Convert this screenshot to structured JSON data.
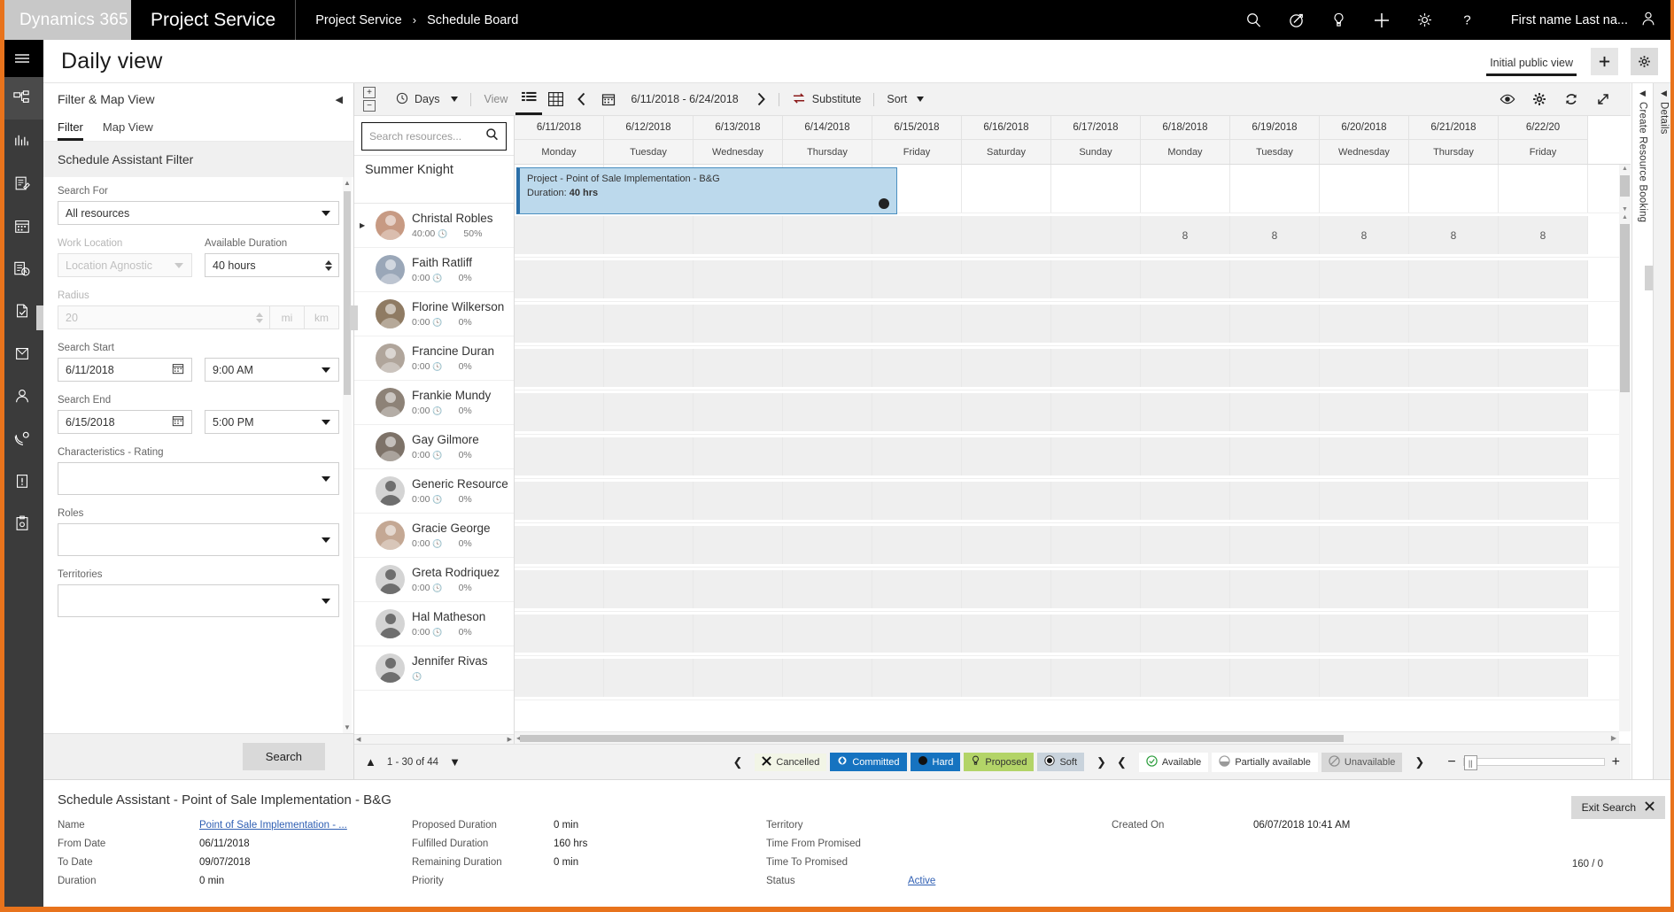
{
  "topnav": {
    "brand": "Dynamics 365",
    "app_name": "Project Service",
    "breadcrumb": [
      "Project Service",
      "Schedule Board"
    ],
    "breadcrumb_sep": "›",
    "icons": [
      "search-icon",
      "assistant-icon",
      "lightbulb-icon",
      "plus-icon",
      "gear-icon",
      "help-icon"
    ],
    "user_name": "First name Last na..."
  },
  "rail": {
    "items": [
      {
        "name": "hamburger-menu"
      },
      {
        "name": "sitemap-icon"
      },
      {
        "name": "dashboard-icon"
      },
      {
        "name": "notes-icon"
      },
      {
        "name": "calendar-icon"
      },
      {
        "name": "schedule-board-icon"
      },
      {
        "name": "document-check-icon"
      },
      {
        "name": "archive-icon"
      },
      {
        "name": "contact-icon"
      },
      {
        "name": "phone-settings-icon"
      },
      {
        "name": "alert-icon"
      },
      {
        "name": "clipboard-settings-icon"
      }
    ]
  },
  "titlebar": {
    "title": "Daily view",
    "view_tab": "Initial public view",
    "add_label": "+",
    "settings_icon": "gear-icon"
  },
  "filter_panel": {
    "header": "Filter & Map View",
    "collapse_icon": "chevron-left-icon",
    "tabs": [
      {
        "label": "Filter",
        "active": true
      },
      {
        "label": "Map View",
        "active": false
      }
    ],
    "section_title": "Schedule Assistant Filter",
    "fields": {
      "search_for": {
        "label": "Search For",
        "value": "All resources"
      },
      "work_location": {
        "label": "Work Location",
        "value": "Location Agnostic",
        "disabled": true
      },
      "available_duration": {
        "label": "Available Duration",
        "value": "40 hours"
      },
      "radius": {
        "label": "Radius",
        "value": "20",
        "unit_mi": "mi",
        "unit_km": "km",
        "disabled": true
      },
      "search_start": {
        "label": "Search Start",
        "date": "6/11/2018",
        "time": "9:00 AM"
      },
      "search_end": {
        "label": "Search End",
        "date": "6/15/2018",
        "time": "5:00 PM"
      },
      "characteristics_rating": {
        "label": "Characteristics - Rating",
        "value": ""
      },
      "roles": {
        "label": "Roles",
        "value": ""
      },
      "territories": {
        "label": "Territories",
        "value": ""
      }
    },
    "search_button": "Search"
  },
  "board_toolbar": {
    "expand_icon": "expand-all-icon",
    "collapse_icon": "collapse-all-icon",
    "scale_label": "Days",
    "view_label": "View",
    "list_view_icon": "list-view-icon",
    "grid_view_icon": "grid-view-icon",
    "prev_icon": "chevron-left-icon",
    "calendar_icon": "calendar-icon",
    "date_range": "6/11/2018 - 6/24/2018",
    "next_icon": "chevron-right-icon",
    "substitute_label": "Substitute",
    "sort_label": "Sort",
    "right_icons": [
      "eye-icon",
      "gear-icon",
      "refresh-icon",
      "fullscreen-icon"
    ]
  },
  "resource_list": {
    "search_placeholder": "Search resources...",
    "search_value": "",
    "search_icon": "search-icon",
    "group_header": "Summer Knight",
    "resources": [
      {
        "name": "Christal Robles",
        "hours": "40:00",
        "pct": "50%",
        "avatar": "photo",
        "tone": "#c79a83",
        "expandable": true
      },
      {
        "name": "Faith Ratliff",
        "hours": "0:00",
        "pct": "0%",
        "avatar": "photo",
        "tone": "#9aa7b8",
        "expandable": false
      },
      {
        "name": "Florine Wilkerson",
        "hours": "0:00",
        "pct": "0%",
        "avatar": "photo",
        "tone": "#8f7b63",
        "expandable": false
      },
      {
        "name": "Francine Duran",
        "hours": "0:00",
        "pct": "0%",
        "avatar": "photo",
        "tone": "#b0a59b",
        "expandable": false
      },
      {
        "name": "Frankie Mundy",
        "hours": "0:00",
        "pct": "0%",
        "avatar": "photo",
        "tone": "#8d8277",
        "expandable": false
      },
      {
        "name": "Gay Gilmore",
        "hours": "0:00",
        "pct": "0%",
        "avatar": "photo",
        "tone": "#7d7268",
        "expandable": false
      },
      {
        "name": "Generic Resource",
        "hours": "0:00",
        "pct": "0%",
        "avatar": "generic",
        "tone": "#d4d4d4",
        "expandable": false
      },
      {
        "name": "Gracie George",
        "hours": "0:00",
        "pct": "0%",
        "avatar": "photo",
        "tone": "#c4a894",
        "expandable": false
      },
      {
        "name": "Greta Rodriquez",
        "hours": "0:00",
        "pct": "0%",
        "avatar": "generic",
        "tone": "#d4d4d4",
        "expandable": false
      },
      {
        "name": "Hal Matheson",
        "hours": "0:00",
        "pct": "0%",
        "avatar": "generic",
        "tone": "#d4d4d4",
        "expandable": false
      },
      {
        "name": "Jennifer Rivas",
        "hours": "",
        "pct": "",
        "avatar": "generic",
        "tone": "#d4d4d4",
        "expandable": false
      }
    ]
  },
  "schedule": {
    "days": [
      {
        "date": "6/11/2018",
        "weekday": "Monday"
      },
      {
        "date": "6/12/2018",
        "weekday": "Tuesday"
      },
      {
        "date": "6/13/2018",
        "weekday": "Wednesday"
      },
      {
        "date": "6/14/2018",
        "weekday": "Thursday"
      },
      {
        "date": "6/15/2018",
        "weekday": "Friday"
      },
      {
        "date": "6/16/2018",
        "weekday": "Saturday"
      },
      {
        "date": "6/17/2018",
        "weekday": "Sunday"
      },
      {
        "date": "6/18/2018",
        "weekday": "Monday"
      },
      {
        "date": "6/19/2018",
        "weekday": "Tuesday"
      },
      {
        "date": "6/20/2018",
        "weekday": "Wednesday"
      },
      {
        "date": "6/21/2018",
        "weekday": "Thursday"
      },
      {
        "date": "6/22/20",
        "weekday": "Friday"
      }
    ],
    "booking": {
      "title": "Project - Point of Sale Implementation - B&G",
      "duration_label": "Duration:",
      "duration_value": "40 hrs"
    },
    "christal_values": [
      "",
      "",
      "",
      "",
      "",
      "",
      "",
      "8",
      "8",
      "8",
      "8",
      "8",
      ""
    ]
  },
  "board_footer": {
    "page_range": "1 - 30 of 44",
    "up_icon": "chevron-up-icon",
    "down_icon": "chevron-down-icon",
    "legend_booking": [
      {
        "label": "Cancelled",
        "key": "cancel",
        "icon": "x-icon"
      },
      {
        "label": "Committed",
        "key": "commit",
        "icon": "diamond-icon"
      },
      {
        "label": "Hard",
        "key": "hard",
        "icon": "filled-circle-icon"
      },
      {
        "label": "Proposed",
        "key": "prop",
        "icon": "lightbulb-icon"
      },
      {
        "label": "Soft",
        "key": "soft",
        "icon": "target-icon"
      }
    ],
    "legend_availability": [
      {
        "label": "Available",
        "key": "av",
        "icon": "check-circle-icon"
      },
      {
        "label": "Partially available",
        "key": "pav",
        "icon": "half-circle-icon"
      },
      {
        "label": "Unavailable",
        "key": "unav",
        "icon": "no-entry-icon"
      }
    ],
    "zoom_out": "−",
    "zoom_in": "+"
  },
  "right_rails": {
    "create_booking": "Create Resource Booking",
    "details": "Details",
    "arrow_icon": "chevron-left-icon"
  },
  "bottom_panel": {
    "title": "Schedule Assistant - Point of Sale Implementation - B&G",
    "exit_label": "Exit Search",
    "exit_icon": "close-icon",
    "col1": [
      {
        "key": "Name",
        "value": "Point of Sale Implementation - ...",
        "link": true
      },
      {
        "key": "From Date",
        "value": "06/11/2018",
        "link": false
      },
      {
        "key": "To Date",
        "value": "09/07/2018",
        "link": false
      },
      {
        "key": "Duration",
        "value": "0 min",
        "link": false
      }
    ],
    "col2": [
      {
        "key": "Proposed Duration",
        "value": "0 min",
        "link": false
      },
      {
        "key": "Fulfilled Duration",
        "value": "160 hrs",
        "link": false
      },
      {
        "key": "Remaining Duration",
        "value": "0 min",
        "link": false
      },
      {
        "key": "Priority",
        "value": "",
        "link": false
      }
    ],
    "col3": [
      {
        "key": "Territory",
        "value": "",
        "link": false
      },
      {
        "key": "Time From Promised",
        "value": "",
        "link": false
      },
      {
        "key": "Time To Promised",
        "value": "",
        "link": false
      },
      {
        "key": "Status",
        "value": "Active",
        "link": true
      }
    ],
    "col4": [
      {
        "key": "Created On",
        "value": "06/07/2018 10:41 AM",
        "link": false
      }
    ],
    "total": "160 / 0"
  },
  "colors": {
    "accent_orange": "#e8731c",
    "booking_blue": "#bcd9ec",
    "booking_border": "#2b6fa8",
    "committed_blue": "#1673c0",
    "proposed_green": "#b3d468",
    "available_green": "#2e9e3e"
  }
}
